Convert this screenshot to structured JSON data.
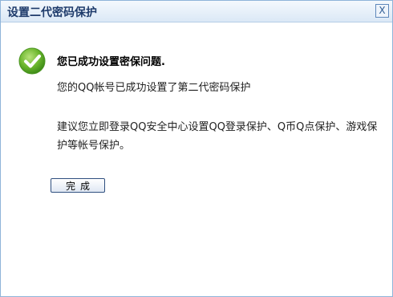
{
  "dialog": {
    "title": "设置二代密码保护",
    "close_label": "X"
  },
  "message": {
    "headline": "您已成功设置密保问题.",
    "line1": "您的QQ帐号已成功设置了第二代密码保护",
    "line2": "建议您立即登录QQ安全中心设置QQ登录保护、Q币Q点保护、游戏保护等帐号保护。"
  },
  "actions": {
    "done_label": "完成"
  },
  "icons": {
    "success": "check-circle-icon"
  },
  "colors": {
    "success_green": "#6bb62c",
    "title_text": "#1e3b6b"
  }
}
